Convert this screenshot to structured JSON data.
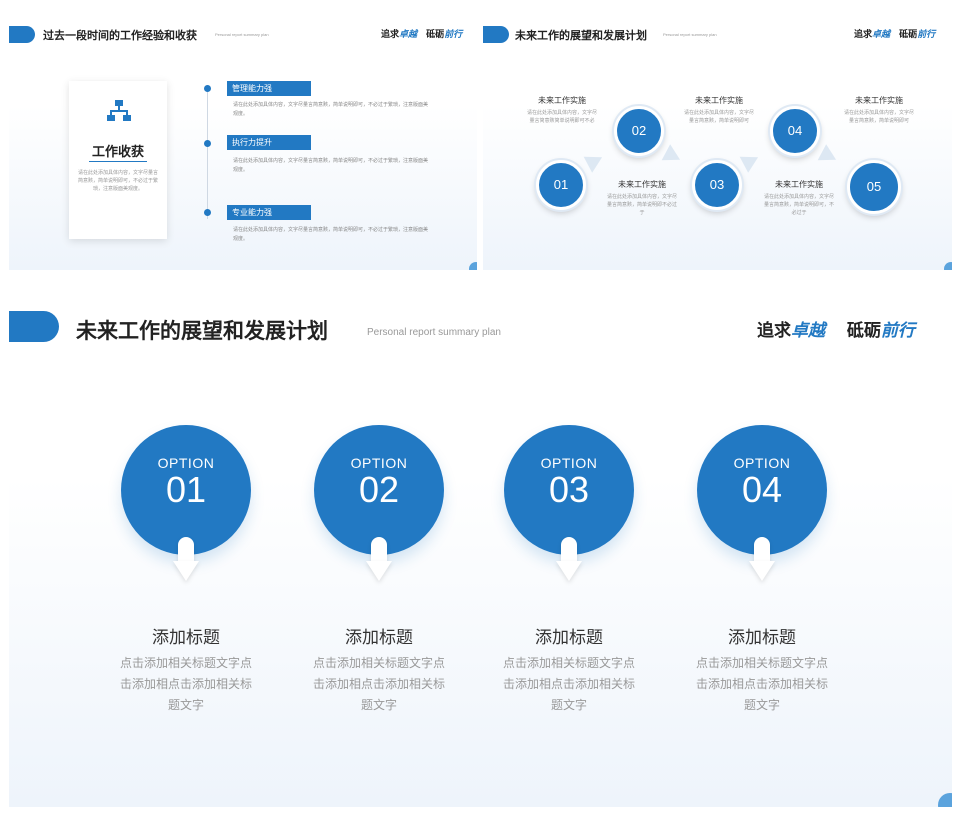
{
  "slide_a": {
    "title": "过去一段时间的工作经验和收获",
    "subtitle": "Personal report summary plan",
    "slogan": {
      "part1": "追求",
      "part1_em": "卓越",
      "part2": "砥砺",
      "part2_em": "前行"
    },
    "card": {
      "icon": "org-chart-icon",
      "title": "工作收获",
      "text": "请在此处添加具体内容，文字尽量言简意赅，简单说明即可，不必过于繁琐，注意版面美观度。"
    },
    "items": [
      {
        "label": "管理能力强",
        "text": "请在此处添加具体内容，文字尽量言简意赅，简单说明即可，不必过于繁琐，注意版面美观度。"
      },
      {
        "label": "执行力提升",
        "text": "请在此处添加具体内容，文字尽量言简意赅，简单说明即可，不必过于繁琐，注意版面美观度。"
      },
      {
        "label": "专业能力强",
        "text": "请在此处添加具体内容，文字尽量言简意赅，简单说明即可，不必过于繁琐，注意版面美观度。"
      }
    ]
  },
  "slide_b": {
    "title": "未来工作的展望和发展计划",
    "subtitle": "Personal report summary plan",
    "slogan": {
      "part1": "追求",
      "part1_em": "卓越",
      "part2": "砥砺",
      "part2_em": "前行"
    },
    "steps": [
      {
        "num": "01"
      },
      {
        "num": "02",
        "label": "未来工作实施",
        "text": "请在此处添加具体内容，文字尽量言简意赅，简单说明即可"
      },
      {
        "num": "03",
        "label": "未来工作实施",
        "text": "请在此处添加具体内容，文字尽量言简意赅，简单说明即不必过于"
      },
      {
        "num": "04",
        "label": "未来工作实施",
        "text": "请在此处添加具体内容，文字尽量言简意赅，简单说明即可"
      },
      {
        "num": "05",
        "label": "未来工作实施",
        "text": "请在此处添加具体内容，文字尽量言简意赅，简单说明即可，不必过于"
      },
      {
        "label": "未来工作实施",
        "text": "请在此处添加具体内容，文字尽量言简意赅简单说明即可不必"
      }
    ]
  },
  "slide_c": {
    "title": "未来工作的展望和发展计划",
    "subtitle": "Personal report summary plan",
    "slogan": {
      "part1": "追求",
      "part1_em": "卓越",
      "part2": "砥砺",
      "part2_em": "前行"
    },
    "options": [
      {
        "option": "OPTION",
        "num": "01",
        "title": "添加标题",
        "text": "点击添加相关标题文字点击添加相点击添加相关标题文字"
      },
      {
        "option": "OPTION",
        "num": "02",
        "title": "添加标题",
        "text": "点击添加相关标题文字点击添加相点击添加相关标题文字"
      },
      {
        "option": "OPTION",
        "num": "03",
        "title": "添加标题",
        "text": "点击添加相关标题文字点击添加相点击添加相关标题文字"
      },
      {
        "option": "OPTION",
        "num": "04",
        "title": "添加标题",
        "text": "点击添加相关标题文字点击添加相点击添加相关标题文字"
      }
    ]
  },
  "colors": {
    "accent": "#2279c3",
    "light_accent": "#5ba3dd",
    "background_fade": "#eef4fb"
  }
}
